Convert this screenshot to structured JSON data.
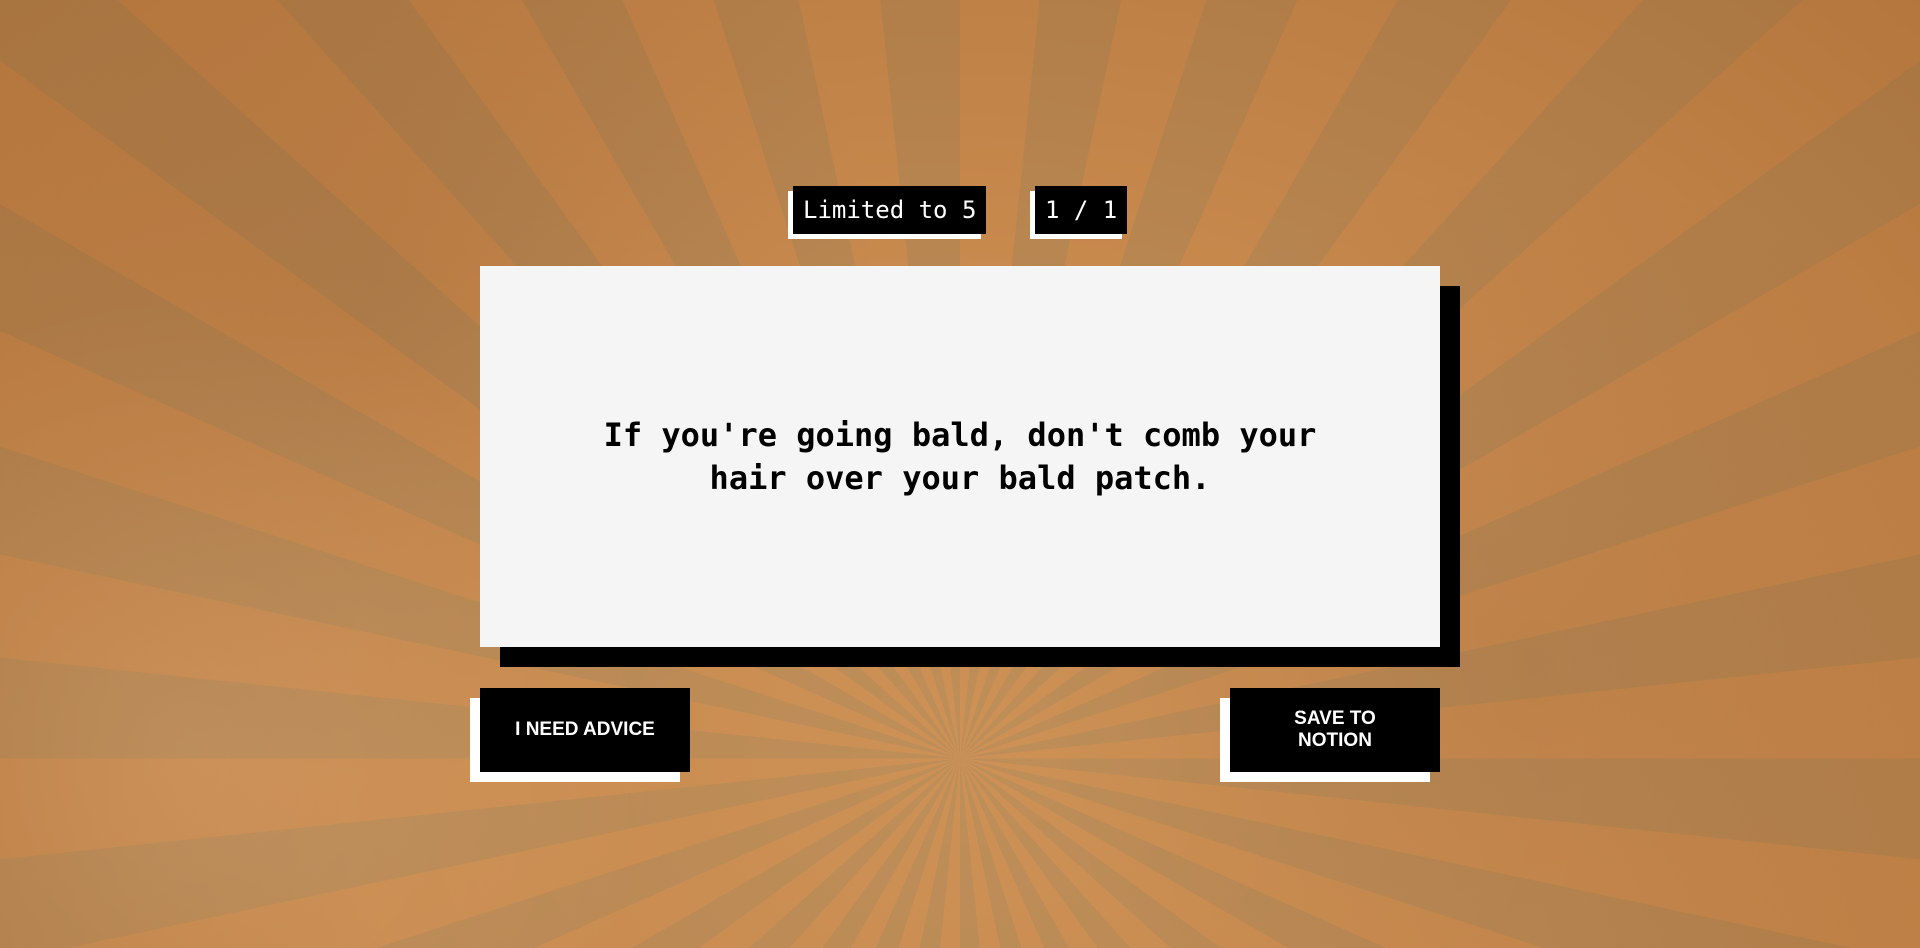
{
  "header": {
    "limit_label": "Limited to 5",
    "page_indicator": "1 / 1"
  },
  "card": {
    "advice": "If you're going bald, don't comb your hair over your bald patch."
  },
  "actions": {
    "advice_button": "I NEED ADVICE",
    "save_button": "SAVE TO NOTION"
  },
  "colors": {
    "background": "#b07a45",
    "card": "#f5f5f5",
    "button": "#000000",
    "button_text": "#ffffff"
  }
}
